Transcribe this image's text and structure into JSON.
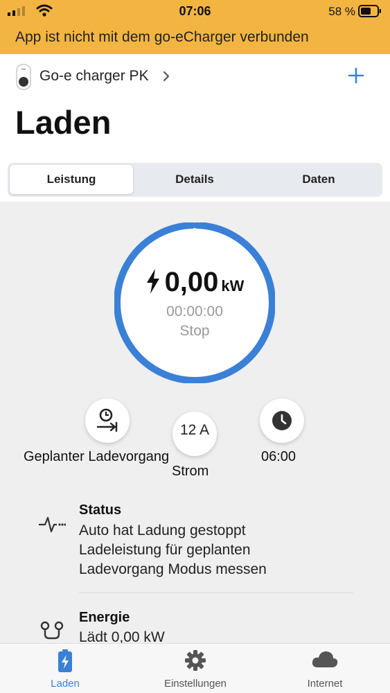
{
  "status_bar": {
    "time": "07:06",
    "battery": "58 %"
  },
  "banner": {
    "text": "App ist nicht mit dem go-eCharger verbunden"
  },
  "header": {
    "device_name": "Go-e charger PK",
    "title": "Laden"
  },
  "tabs": [
    {
      "label": "Leistung",
      "active": true
    },
    {
      "label": "Details",
      "active": false
    },
    {
      "label": "Daten",
      "active": false
    }
  ],
  "gauge": {
    "power": "0,00",
    "unit": "kW",
    "duration": "00:00:00",
    "state": "Stop",
    "accent": "#3a80d6"
  },
  "controls": {
    "schedule_label": "Geplanter Ladevorgang",
    "current_value": "12 A",
    "current_label": "Strom",
    "time_value": "06:00"
  },
  "info": {
    "status": {
      "title": "Status",
      "lines": [
        "Auto hat Ladung gestoppt",
        "Ladeleistung für geplanten",
        "Ladevorgang Modus messen"
      ]
    },
    "energy": {
      "title": "Energie",
      "line": "Lädt 0,00 kW"
    }
  },
  "tabbar": [
    {
      "label": "Laden",
      "icon": "battery-charging-icon",
      "active": true
    },
    {
      "label": "Einstellungen",
      "icon": "gear-icon",
      "active": false
    },
    {
      "label": "Internet",
      "icon": "cloud-icon",
      "active": false
    }
  ],
  "colors": {
    "banner": "#f3b541",
    "accent": "#3a80d6",
    "background": "#efefef"
  }
}
